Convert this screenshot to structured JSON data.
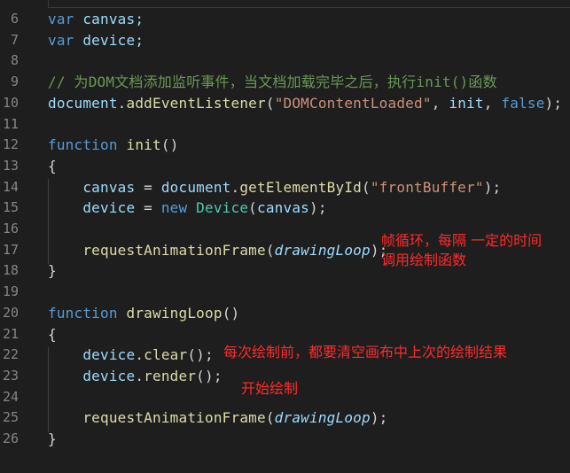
{
  "lines": [
    {
      "n": "6",
      "tokens": [
        {
          "t": "var",
          "c": "kw"
        },
        {
          "t": " canvas;",
          "c": "var"
        }
      ]
    },
    {
      "n": "7",
      "tokens": [
        {
          "t": "var",
          "c": "kw"
        },
        {
          "t": " device;",
          "c": "var"
        }
      ]
    },
    {
      "n": "8",
      "tokens": []
    },
    {
      "n": "9",
      "tokens": [
        {
          "t": "// 为DOM文档添加监听事件，当文档加载完毕之后，执行init()函数",
          "c": "cmt"
        }
      ]
    },
    {
      "n": "10",
      "tokens": [
        {
          "t": "document",
          "c": "var"
        },
        {
          "t": ".",
          "c": "punc"
        },
        {
          "t": "addEventListener",
          "c": "fn"
        },
        {
          "t": "(",
          "c": "punc"
        },
        {
          "t": "\"DOMContentLoaded\"",
          "c": "str"
        },
        {
          "t": ", ",
          "c": "punc"
        },
        {
          "t": "init",
          "c": "var"
        },
        {
          "t": ", ",
          "c": "punc"
        },
        {
          "t": "false",
          "c": "kw"
        },
        {
          "t": ");",
          "c": "punc"
        }
      ]
    },
    {
      "n": "11",
      "tokens": []
    },
    {
      "n": "12",
      "tokens": [
        {
          "t": "function",
          "c": "kw"
        },
        {
          "t": " ",
          "c": "punc"
        },
        {
          "t": "init",
          "c": "fn"
        },
        {
          "t": "()",
          "c": "punc"
        }
      ]
    },
    {
      "n": "13",
      "tokens": [
        {
          "t": "{",
          "c": "punc"
        }
      ]
    },
    {
      "n": "14",
      "tokens": [
        {
          "t": "    canvas",
          "c": "var"
        },
        {
          "t": " = ",
          "c": "punc"
        },
        {
          "t": "document",
          "c": "var"
        },
        {
          "t": ".",
          "c": "punc"
        },
        {
          "t": "getElementById",
          "c": "fn"
        },
        {
          "t": "(",
          "c": "punc"
        },
        {
          "t": "\"frontBuffer\"",
          "c": "str"
        },
        {
          "t": ");",
          "c": "punc"
        }
      ]
    },
    {
      "n": "15",
      "tokens": [
        {
          "t": "    device",
          "c": "var"
        },
        {
          "t": " = ",
          "c": "punc"
        },
        {
          "t": "new",
          "c": "kw"
        },
        {
          "t": " ",
          "c": "punc"
        },
        {
          "t": "Device",
          "c": "cls"
        },
        {
          "t": "(",
          "c": "punc"
        },
        {
          "t": "canvas",
          "c": "var"
        },
        {
          "t": ");",
          "c": "punc"
        }
      ]
    },
    {
      "n": "16",
      "tokens": []
    },
    {
      "n": "17",
      "tokens": [
        {
          "t": "    requestAnimationFrame",
          "c": "fn"
        },
        {
          "t": "(",
          "c": "punc"
        },
        {
          "t": "drawingLoop",
          "c": "param"
        },
        {
          "t": ");",
          "c": "punc"
        }
      ]
    },
    {
      "n": "18",
      "tokens": [
        {
          "t": "}",
          "c": "punc"
        }
      ]
    },
    {
      "n": "19",
      "tokens": []
    },
    {
      "n": "20",
      "tokens": [
        {
          "t": "function",
          "c": "kw"
        },
        {
          "t": " ",
          "c": "punc"
        },
        {
          "t": "drawingLoop",
          "c": "fn"
        },
        {
          "t": "()",
          "c": "punc"
        }
      ]
    },
    {
      "n": "21",
      "tokens": [
        {
          "t": "{",
          "c": "punc"
        }
      ]
    },
    {
      "n": "22",
      "tokens": [
        {
          "t": "    device",
          "c": "var"
        },
        {
          "t": ".",
          "c": "punc"
        },
        {
          "t": "clear",
          "c": "fn"
        },
        {
          "t": "();",
          "c": "punc"
        }
      ]
    },
    {
      "n": "23",
      "tokens": [
        {
          "t": "    device",
          "c": "var"
        },
        {
          "t": ".",
          "c": "punc"
        },
        {
          "t": "render",
          "c": "fn"
        },
        {
          "t": "();",
          "c": "punc"
        }
      ]
    },
    {
      "n": "24",
      "tokens": []
    },
    {
      "n": "25",
      "tokens": [
        {
          "t": "    requestAnimationFrame",
          "c": "fn"
        },
        {
          "t": "(",
          "c": "punc"
        },
        {
          "t": "drawingLoop",
          "c": "param"
        },
        {
          "t": ");",
          "c": "punc"
        }
      ]
    },
    {
      "n": "26",
      "tokens": [
        {
          "t": "}",
          "c": "punc"
        }
      ]
    }
  ],
  "annotations": {
    "frame_loop_line1": "帧循环，每隔 一定的时间",
    "frame_loop_line2": "调用绘制函数",
    "clear_note": "每次绘制前，都要清空画布中上次的绘制结果",
    "render_note": "开始绘制"
  },
  "colors": {
    "background": "#1e1e1e",
    "keyword": "#569cd6",
    "variable": "#9cdcfe",
    "function": "#dcdcaa",
    "string": "#ce9178",
    "comment": "#6a9955",
    "class": "#4ec9b0",
    "annotation": "#ff2a2a"
  }
}
